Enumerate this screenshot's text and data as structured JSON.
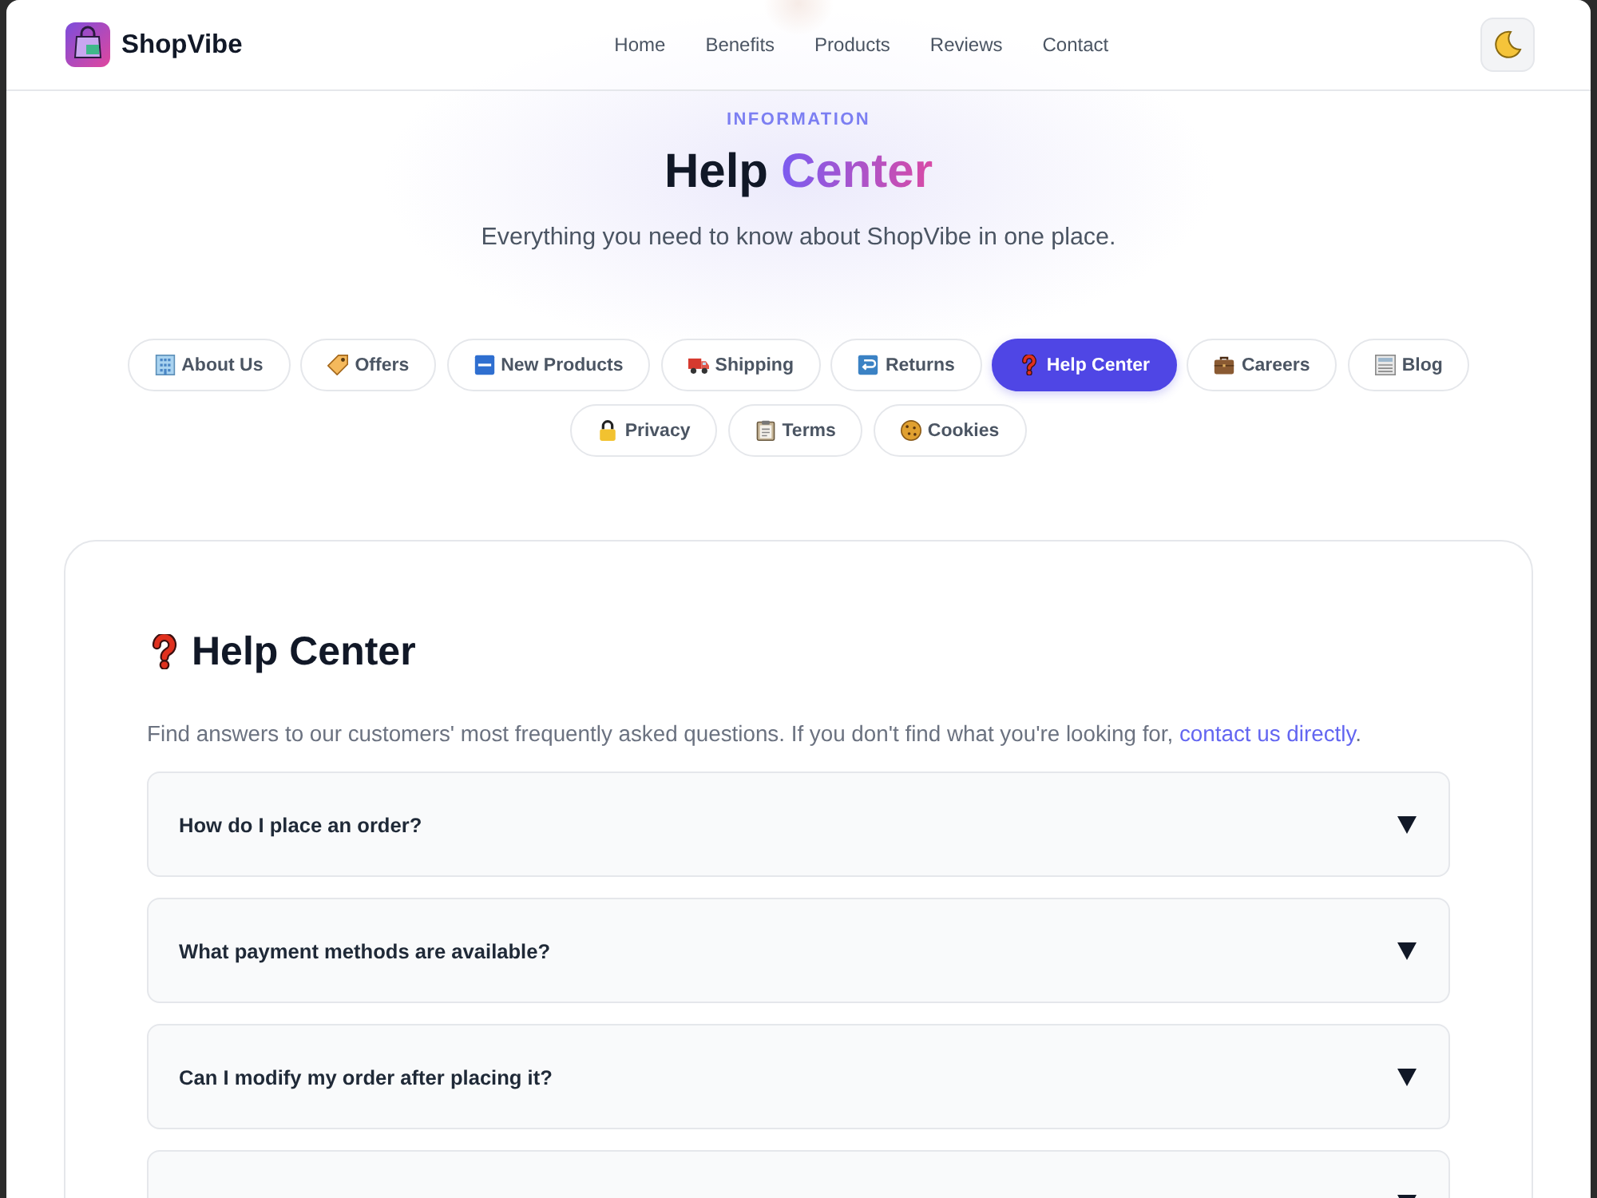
{
  "navbar": {
    "brand": "ShopVibe",
    "links": [
      "Home",
      "Benefits",
      "Products",
      "Reviews",
      "Contact"
    ]
  },
  "hero": {
    "eyebrow": "INFORMATION",
    "title": "Help",
    "title_highlight": "Center",
    "subtitle": "Everything you need to know about ShopVibe in one place."
  },
  "tabs": [
    {
      "label": "About Us",
      "kind": "building",
      "selected": false
    },
    {
      "label": "Offers",
      "kind": "tag",
      "selected": false
    },
    {
      "label": "New Products",
      "kind": "new",
      "selected": false
    },
    {
      "label": "Shipping",
      "kind": "truck",
      "selected": false
    },
    {
      "label": "Returns",
      "kind": "return",
      "selected": false
    },
    {
      "label": "Help Center",
      "kind": "question",
      "selected": true
    },
    {
      "label": "Careers",
      "kind": "briefcase",
      "selected": false
    },
    {
      "label": "Blog",
      "kind": "newspaper",
      "selected": false
    },
    {
      "label": "Privacy",
      "kind": "lock",
      "selected": false
    },
    {
      "label": "Terms",
      "kind": "clipboard",
      "selected": false
    },
    {
      "label": "Cookies",
      "kind": "cookie",
      "selected": false
    }
  ],
  "content": {
    "title": "Help Center",
    "intro": "Find answers to our customers' most frequently asked questions. If you don't find what you're looking for, ",
    "link": "contact us directly",
    "intro_end": ".",
    "faq": [
      {
        "question": "How do I place an order?",
        "expanded": false
      },
      {
        "question": "What payment methods are available?",
        "expanded": false
      },
      {
        "question": "Can I modify my order after placing it?",
        "expanded": false
      },
      {
        "expanded": false
      }
    ]
  }
}
